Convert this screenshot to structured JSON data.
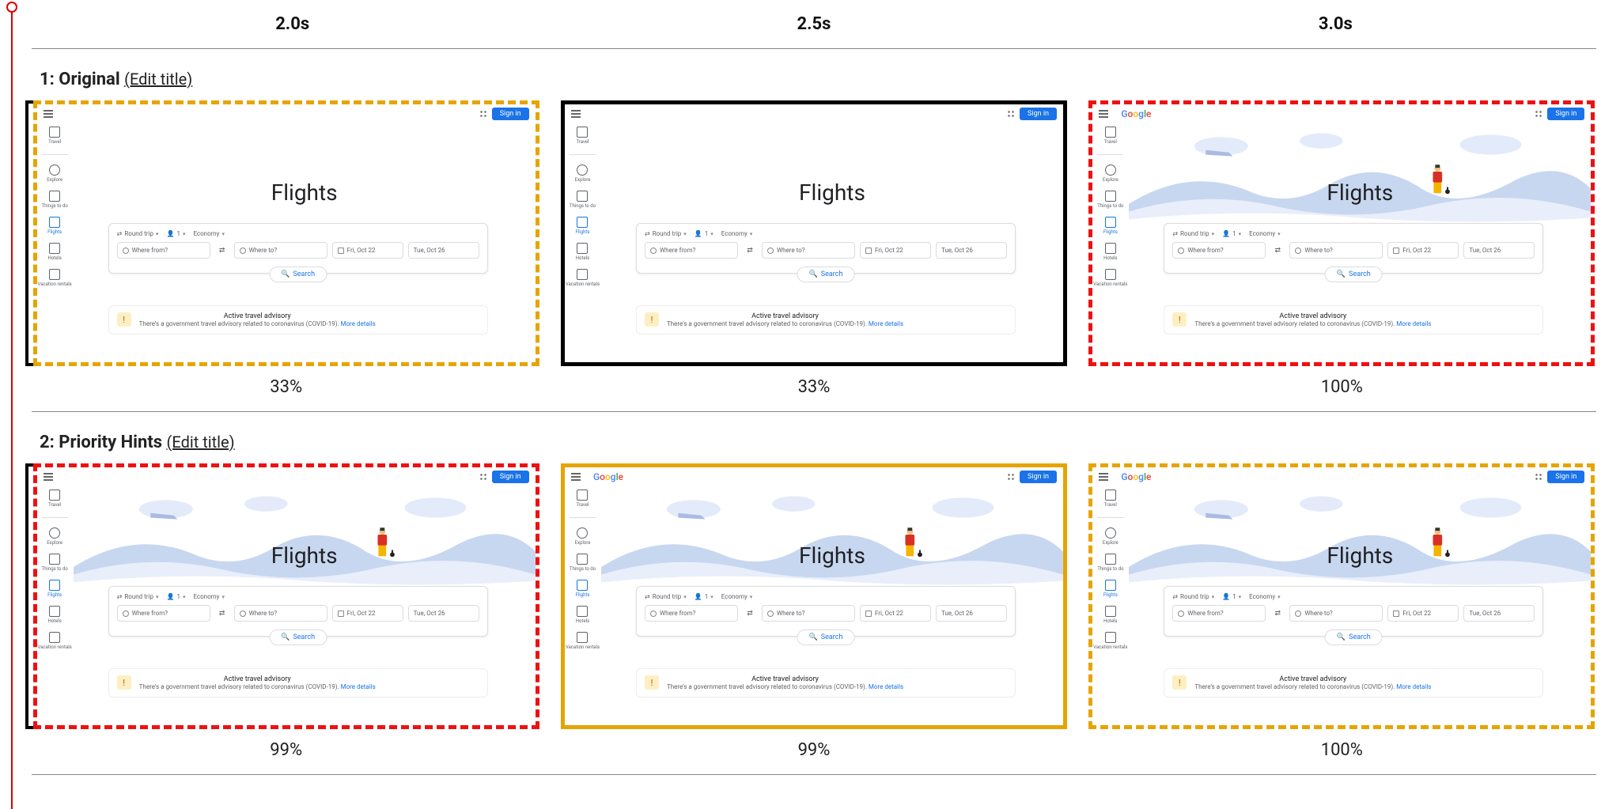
{
  "time_headers": [
    "2.0s",
    "2.5s",
    "3.0s"
  ],
  "sections": [
    {
      "index": "1",
      "label": "Original",
      "edit": "(Edit title)",
      "frames": [
        {
          "border": "dotted-orange",
          "bracket": true,
          "logo": false,
          "hero": false,
          "scrollbar": true,
          "pct": "33%"
        },
        {
          "border": "solid-black",
          "bracket": false,
          "logo": false,
          "hero": false,
          "scrollbar": true,
          "pct": "33%"
        },
        {
          "border": "dotted-red",
          "bracket": false,
          "logo": true,
          "hero": true,
          "scrollbar": false,
          "pct": "100%"
        }
      ]
    },
    {
      "index": "2",
      "label": "Priority Hints",
      "edit": "(Edit title)",
      "frames": [
        {
          "border": "dotted-red",
          "bracket": true,
          "logo": false,
          "hero": true,
          "scrollbar": true,
          "pct": "99%"
        },
        {
          "border": "solid-orange",
          "bracket": false,
          "logo": true,
          "hero": true,
          "scrollbar": true,
          "pct": "99%"
        },
        {
          "border": "dotted-orange",
          "bracket": false,
          "logo": true,
          "hero": true,
          "scrollbar": false,
          "pct": "100%"
        }
      ]
    }
  ],
  "thumb": {
    "signin": "Sign in",
    "sidebar": [
      "Travel",
      "Explore",
      "Things to do",
      "Flights",
      "Hotels",
      "Vacation rentals"
    ],
    "sidebar_active": 3,
    "title": "Flights",
    "trip_type": "Round trip",
    "pax": "1",
    "cabin": "Economy",
    "from_ph": "Where from?",
    "to_ph": "Where to?",
    "date1": "Fri, Oct 22",
    "date2": "Tue, Oct 26",
    "search": "Search",
    "advisory_title": "Active travel advisory",
    "advisory_sub": "There's a government travel advisory related to coronavirus (COVID-19).",
    "advisory_link": "More details"
  }
}
